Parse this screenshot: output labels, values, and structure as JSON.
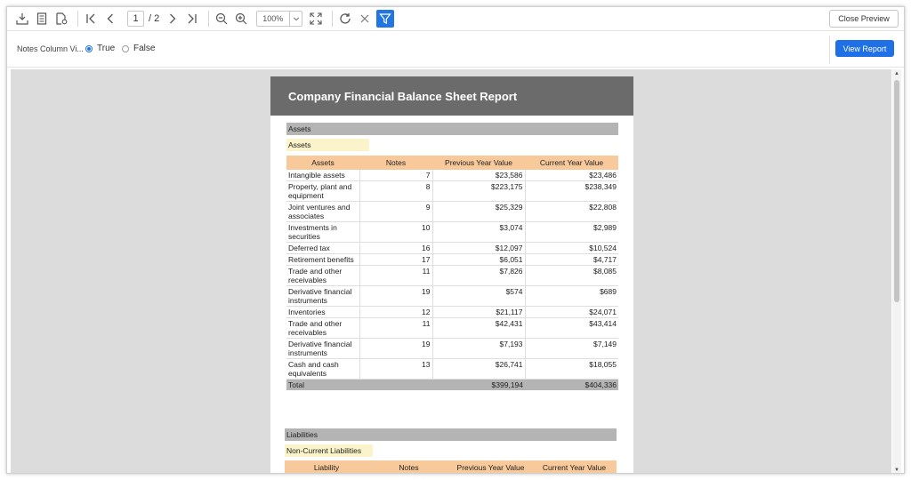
{
  "toolbar": {
    "page_current": "1",
    "page_total": "/ 2",
    "zoom": "100%",
    "close_preview": "Close Preview"
  },
  "params": {
    "label": "Notes Column Vi...",
    "option_true": "True",
    "option_false": "False",
    "selected": "True",
    "view_report": "View Report"
  },
  "report": {
    "title": "Company Financial Balance Sheet Report",
    "assets_section": "Assets",
    "assets_subsection": "Assets",
    "assets_headers": [
      "Assets",
      "Notes",
      "Previous Year Value",
      "Current Year Value"
    ],
    "assets_rows": [
      {
        "name": "Intangible assets",
        "notes": "7",
        "prev": "$23,586",
        "curr": "$23,486"
      },
      {
        "name": "Property, plant and equipment",
        "notes": "8",
        "prev": "$223,175",
        "curr": "$238,349"
      },
      {
        "name": "Joint ventures and associates",
        "notes": "9",
        "prev": "$25,329",
        "curr": "$22,808"
      },
      {
        "name": "Investments in securities",
        "notes": "10",
        "prev": "$3,074",
        "curr": "$2,989"
      },
      {
        "name": "Deferred tax",
        "notes": "16",
        "prev": "$12,097",
        "curr": "$10,524"
      },
      {
        "name": "Retirement benefits",
        "notes": "17",
        "prev": "$6,051",
        "curr": "$4,717"
      },
      {
        "name": "Trade and other receivables",
        "notes": "11",
        "prev": "$7,826",
        "curr": "$8,085"
      },
      {
        "name": "Derivative financial instruments",
        "notes": "19",
        "prev": "$574",
        "curr": "$689"
      },
      {
        "name": "Inventories",
        "notes": "12",
        "prev": "$21,117",
        "curr": "$24,071"
      },
      {
        "name": "Trade and other receivables",
        "notes": "11",
        "prev": "$42,431",
        "curr": "$43,414"
      },
      {
        "name": "Derivative financial instruments",
        "notes": "19",
        "prev": "$7,193",
        "curr": "$7,149"
      },
      {
        "name": "Cash and cash equivalents",
        "notes": "13",
        "prev": "$26,741",
        "curr": "$18,055"
      }
    ],
    "assets_total": {
      "label": "Total",
      "prev": "$399,194",
      "curr": "$404,336"
    },
    "liabilities_section": "Liabilities",
    "liabilities_subsection": "Non-Current Liabilities",
    "liabilities_headers": [
      "Liability",
      "Notes",
      "Previous Year Value",
      "Current Year Value"
    ]
  }
}
